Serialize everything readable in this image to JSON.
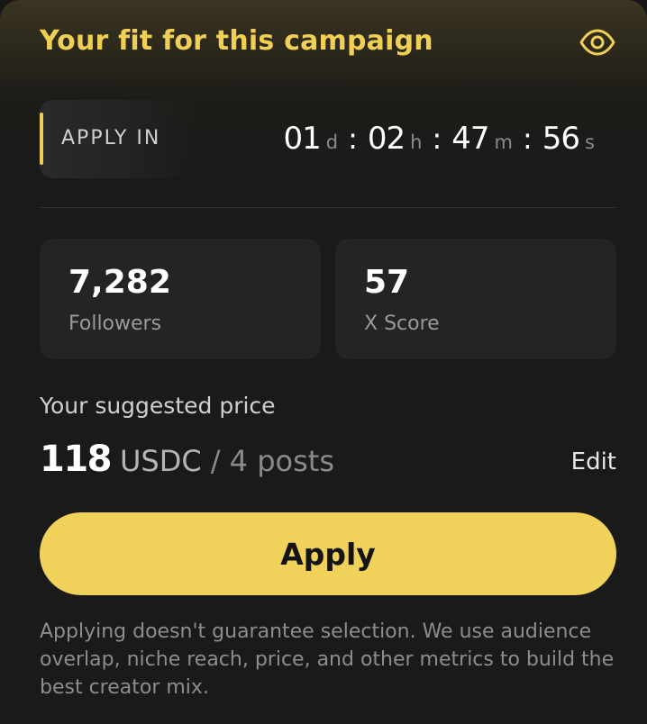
{
  "colors": {
    "accent": "#f0cf55",
    "button": "#f0d15a",
    "card_background": "#1a1a1a",
    "tile_background": "#242424"
  },
  "header": {
    "title": "Your fit for this campaign",
    "icon": "eye-icon"
  },
  "countdown": {
    "label": "APPLY IN",
    "days": "01",
    "days_unit": "d",
    "hours": "02",
    "hours_unit": "h",
    "minutes": "47",
    "minutes_unit": "m",
    "seconds": "56",
    "seconds_unit": "s",
    "separator": ":"
  },
  "stats": {
    "followers": {
      "value": "7,282",
      "label": "Followers"
    },
    "x_score": {
      "value": "57",
      "label": "X Score"
    }
  },
  "pricing": {
    "label": "Your suggested price",
    "amount": "118",
    "currency": "USDC",
    "per": "/ 4 posts",
    "edit_label": "Edit"
  },
  "apply_button": {
    "label": "Apply"
  },
  "disclaimer": "Applying doesn't guarantee selection. We use audience overlap, niche reach, price, and other metrics to build the best creator mix."
}
